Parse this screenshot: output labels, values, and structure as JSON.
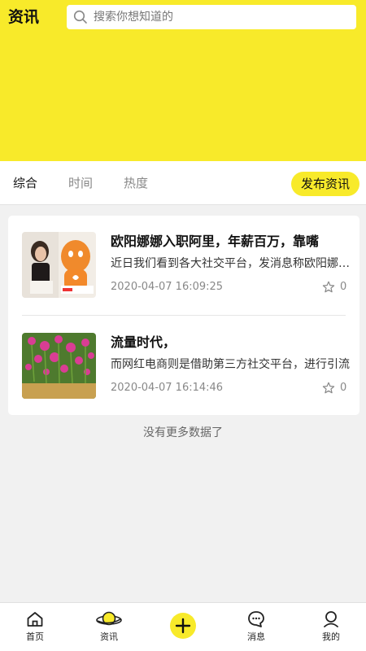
{
  "header": {
    "title": "资讯",
    "search_placeholder": "搜索你想知道的"
  },
  "tabs": [
    {
      "label": "综合",
      "active": true
    },
    {
      "label": "时间",
      "active": false
    },
    {
      "label": "热度",
      "active": false
    }
  ],
  "publish_label": "发布资讯",
  "articles": [
    {
      "title": "欧阳娜娜入职阿里，年薪百万，靠嘴",
      "desc": "近日我们看到各大社交平台，发消息称欧阳娜娜入职阿里",
      "time": "2020-04-07 16:09:25",
      "likes": "0"
    },
    {
      "title": "流量时代，",
      "desc": "而网红电商则是借助第三方社交平台，进行引流",
      "time": "2020-04-07 16:14:46",
      "likes": "0"
    }
  ],
  "no_more_text": "没有更多数据了",
  "tabbar": [
    {
      "label": "首页",
      "icon": "home-icon"
    },
    {
      "label": "资讯",
      "icon": "planet-icon"
    },
    {
      "label": "",
      "icon": "plus-icon"
    },
    {
      "label": "消息",
      "icon": "chat-icon"
    },
    {
      "label": "我的",
      "icon": "user-icon"
    }
  ],
  "colors": {
    "accent": "#f8ea2a",
    "background": "#f1f1f1"
  }
}
